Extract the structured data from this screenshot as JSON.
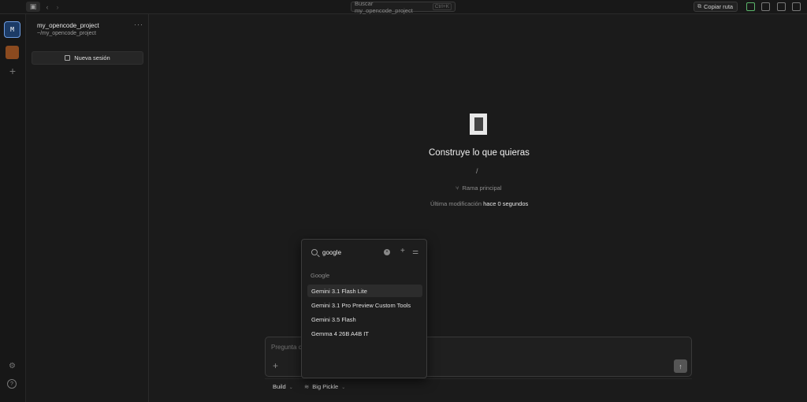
{
  "topbar": {
    "search_placeholder": "Buscar my_opencode_project",
    "search_shortcut": "Ctrl+K",
    "copy_path_label": "Copiar ruta"
  },
  "rail": {
    "workspace_letter": "M"
  },
  "sidebar": {
    "project_name": "my_opencode_project",
    "project_path": "~/my_opencode_project",
    "more": "···",
    "new_session_label": "Nueva sesión"
  },
  "main": {
    "headline": "Construye lo que quieras",
    "path_slash": "/",
    "branch_label": "Rama principal",
    "modified_label": "Última modificación",
    "modified_value": "hace 0 segundos"
  },
  "composer": {
    "placeholder": "Pregunta c",
    "mode": "Build",
    "model": "Big Pickle"
  },
  "model_picker": {
    "search_value": "google",
    "group": "Google",
    "items": [
      "Gemini 3.1 Flash Lite",
      "Gemini 3.1 Pro Preview Custom Tools",
      "Gemini 3.5 Flash",
      "Gemma 4 26B A4B IT"
    ]
  },
  "colors": {
    "background": "#1b1b1b",
    "accent_blue": "#6c9be0",
    "project_orange": "#8b4a1f"
  }
}
